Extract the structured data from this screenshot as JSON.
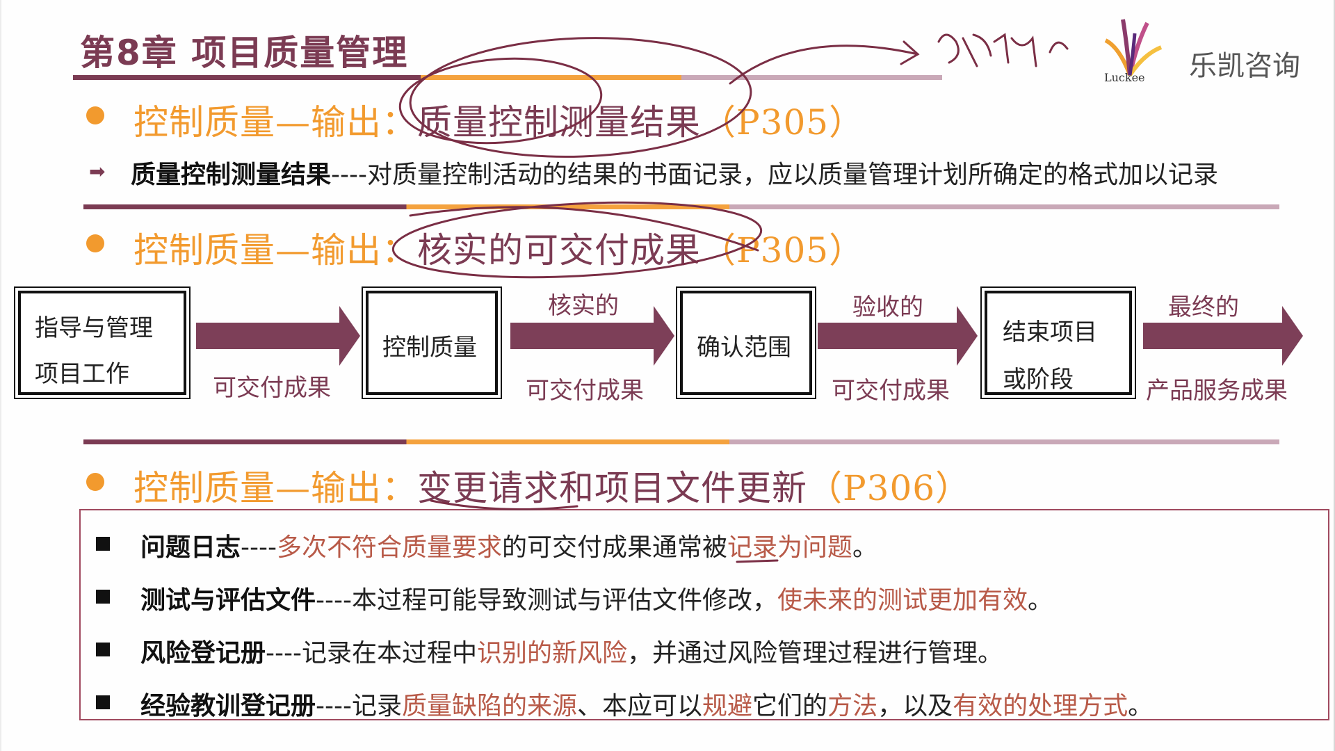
{
  "header": {
    "chapter_title": "第8章 项目质量管理",
    "brand": "乐凯咨询",
    "logo_text": "Luckee"
  },
  "section1": {
    "prefix": "控制质量—输出：",
    "highlight": "质量控制测量结果",
    "suffix": "（P305）",
    "definition_term": "质量控制测量结果",
    "definition_text": "----对质量控制活动的结果的书面记录，应以质量管理计划所确定的格式加以记录"
  },
  "section2": {
    "prefix": "控制质量—输出：",
    "highlight": "核实的可交付成果",
    "suffix": "（P305）",
    "flow": {
      "boxes": [
        {
          "line1": "指导与管理",
          "line2": "项目工作"
        },
        {
          "line1": "控制质量"
        },
        {
          "line1": "确认范围"
        },
        {
          "line1": "结束项目",
          "line2": "或阶段"
        }
      ],
      "arrows": [
        {
          "top": "",
          "bottom": "可交付成果"
        },
        {
          "top": "核实的",
          "bottom": "可交付成果"
        },
        {
          "top": "验收的",
          "bottom": "可交付成果"
        },
        {
          "top": "最终的",
          "bottom": "产品服务成果"
        }
      ]
    }
  },
  "section3": {
    "prefix": "控制质量—输出：",
    "highlight": "变更请求和项目文件更新",
    "suffix": "（P306）",
    "items": [
      {
        "term": "问题日志",
        "dash": "----",
        "p1": "多次不符合质量要求",
        "p2": "的可交付成果通常被",
        "p3": "记录为问题",
        "p4": "。"
      },
      {
        "term": "测试与评估文件",
        "dash": "----",
        "p1": "本过程可能导致测试与评估文件修改，",
        "p2": "使未来的测试更加有效",
        "p3": "。"
      },
      {
        "term": "风险登记册",
        "dash": "----",
        "p1": "记录在本过程中",
        "p2": "识别的新风险",
        "p3": "，并通过风险管理过程进行管理。"
      },
      {
        "term": "经验教训登记册",
        "dash": "----",
        "p1": "记录",
        "p2": "质量缺陷的来源",
        "p3": "、本应可以",
        "p4": "规避",
        "p5": "它们的",
        "p6": "方法",
        "p7": "，以及",
        "p8": "有效的处理方式",
        "p9": "。"
      }
    ]
  },
  "colors": {
    "accent_orange": "#f29a2e",
    "accent_plum": "#7b3b53",
    "highlight_red": "#b85a48"
  }
}
